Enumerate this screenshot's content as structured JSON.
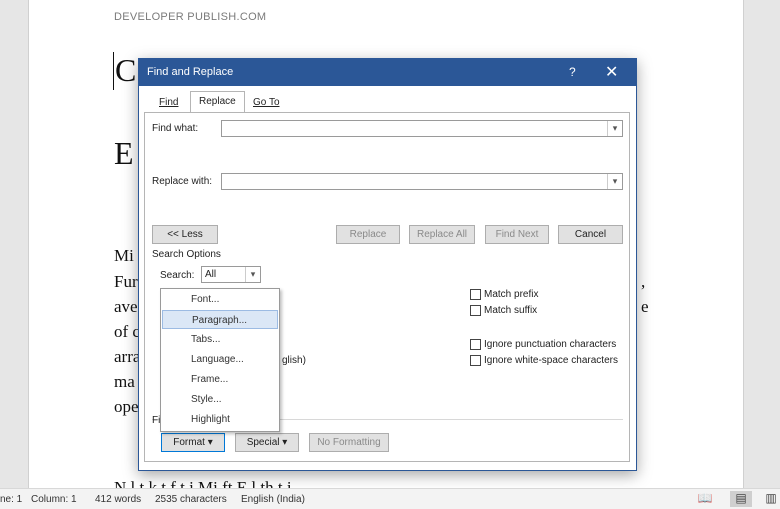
{
  "document": {
    "header": "DEVELOPER PUBLISH.COM",
    "line_c": "C",
    "line_e": "E",
    "body_lines": [
      "Mi",
      "Fur",
      "ave",
      "of c",
      "arra",
      "ma",
      "ope"
    ],
    "right_frag": [
      ",",
      "e"
    ],
    "bottom_line": "N      l t            k      t     f  t       i  Mi        ft E    l th t i"
  },
  "dialog": {
    "title": "Find and Replace",
    "help": "?",
    "close": "✕",
    "tabs": [
      {
        "label": "Find",
        "active": false
      },
      {
        "label": "Replace",
        "active": true
      },
      {
        "label": "Go To",
        "active": false
      }
    ],
    "find_label": "Find what:",
    "find_value": "",
    "replace_label": "Replace with:",
    "replace_value": "",
    "buttons": {
      "less": "<< Less",
      "replace": "Replace",
      "replace_all": "Replace All",
      "find_next": "Find Next",
      "cancel": "Cancel"
    },
    "search_options_label": "Search Options",
    "search_label": "Search:",
    "search_value": "All",
    "options_right": [
      {
        "label": "Match prefix",
        "checked": false
      },
      {
        "label": "Match suffix",
        "checked": false
      },
      {
        "label": "Ignore punctuation characters",
        "checked": false
      },
      {
        "label": "Ignore white-space characters",
        "checked": false
      }
    ],
    "partial_option": "glish)",
    "find_section_label": "Fi",
    "format_button": "Format ▾",
    "special_button": "Special ▾",
    "no_formatting_button": "No Formatting"
  },
  "format_menu": {
    "items": [
      "Font...",
      "Paragraph...",
      "Tabs...",
      "Language...",
      "Frame...",
      "Style...",
      "Highlight"
    ],
    "hover_index": 1
  },
  "statusbar": {
    "line": "ne: 1",
    "column": "Column: 1",
    "words": "412 words",
    "characters": "2535 characters",
    "language": "English (India)"
  }
}
